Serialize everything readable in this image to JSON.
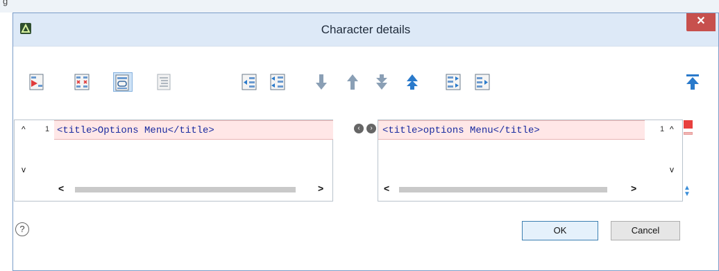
{
  "background_title": "g",
  "dialog": {
    "title": "Character details",
    "close_glyph": "✕"
  },
  "toolbar": {
    "icons": [
      "generate-diff-icon",
      "compare-files-icon",
      "link-scroll-icon",
      "format-text-icon",
      "merge-left-icon",
      "merge-all-left-icon",
      "next-diff-icon",
      "prev-diff-icon",
      "next-change-icon",
      "prev-change-icon",
      "merge-right-icon",
      "merge-all-right-icon",
      "first-diff-icon"
    ]
  },
  "left_pane": {
    "line_number": "1",
    "code": "<title>Options Menu</title>"
  },
  "right_pane": {
    "line_number": "1",
    "code": "<title>options Menu</title>"
  },
  "scroll_glyphs": {
    "up": "^",
    "down": "v",
    "left": "<",
    "right": ">"
  },
  "footer": {
    "help_glyph": "?",
    "ok_label": "OK",
    "cancel_label": "Cancel"
  },
  "colors": {
    "accent": "#3a8ed9",
    "diff_bg": "#ffe7e7",
    "close_red": "#c7504d"
  }
}
